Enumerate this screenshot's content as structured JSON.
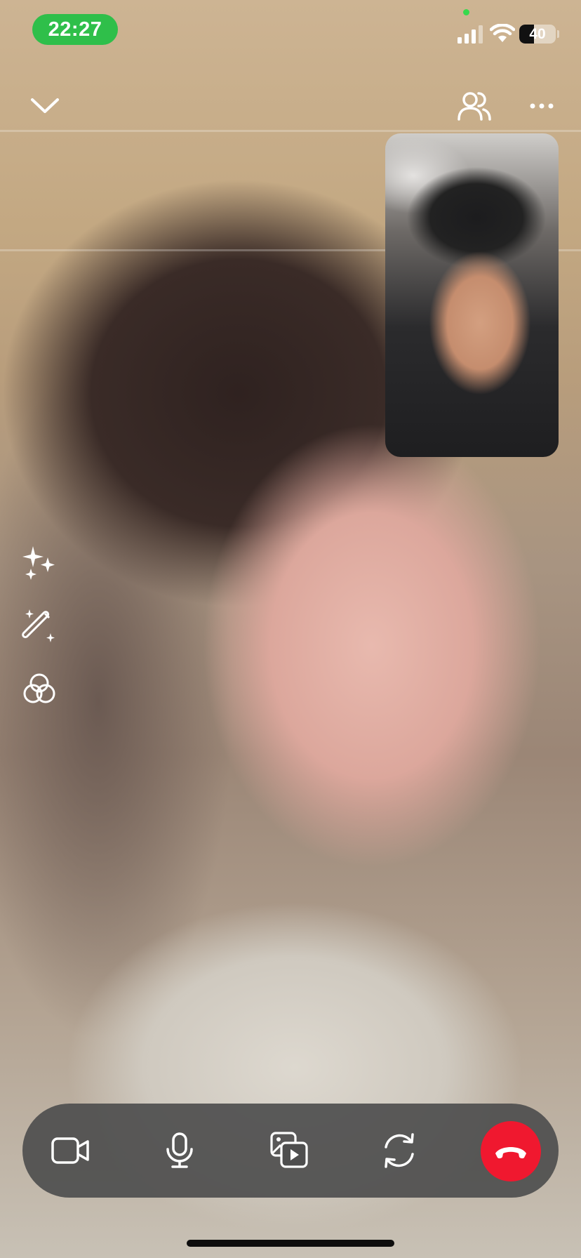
{
  "status_bar": {
    "time": "22:27",
    "battery_percent": "40",
    "battery_level": 0.4,
    "signal_icon": "cellular-signal-icon",
    "wifi_icon": "wifi-icon",
    "camera_indicator_color": "#36d94d",
    "time_pill_color": "#2fbf4a"
  },
  "top_bar": {
    "collapse_icon": "chevron-down-icon",
    "participants_icon": "participants-icon",
    "more_icon": "more-horizontal-icon"
  },
  "video": {
    "remote_stream": "remote-video",
    "self_view": "self-view-video"
  },
  "side_tools": [
    {
      "icon": "sparkles-icon"
    },
    {
      "icon": "magic-wand-icon"
    },
    {
      "icon": "color-filter-icon"
    }
  ],
  "call_controls": {
    "camera_icon": "video-camera-icon",
    "mic_icon": "microphone-icon",
    "share_icon": "share-media-icon",
    "flip_icon": "flip-camera-icon",
    "end_call_icon": "hang-up-icon",
    "end_call_color": "#f0182f",
    "bar_color": "#4e4e4e"
  }
}
